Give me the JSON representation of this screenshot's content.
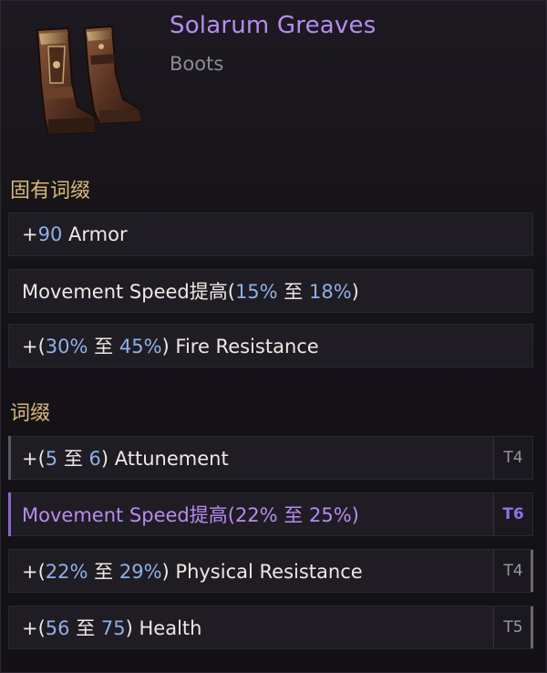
{
  "item": {
    "name": "Solarum Greaves",
    "type": "Boots"
  },
  "implicit": {
    "title": "固有词缀",
    "rows": [
      {
        "prefix": "+",
        "num1": "90",
        "suffix": " Armor"
      },
      {
        "text": "Movement Speed提高(",
        "num1": "15%",
        "mid": " 至 ",
        "num2": "18%",
        "end": ")"
      },
      {
        "prefix": "+(",
        "num1": "30%",
        "mid": " 至 ",
        "num2": "45%",
        "end": ") Fire Resistance"
      }
    ]
  },
  "affixes": {
    "title": "词缀",
    "rows": [
      {
        "prefix": "+(",
        "num1": "5",
        "mid": " 至 ",
        "num2": "6",
        "end": ") Attunement",
        "tier": "T4"
      },
      {
        "text": "Movement Speed提高(",
        "num1": "22%",
        "mid": " 至 ",
        "num2": "25%",
        "end": ")",
        "tier": "T6"
      },
      {
        "prefix": "+(",
        "num1": "22%",
        "mid": " 至 ",
        "num2": "29%",
        "end": ") Physical Resistance",
        "tier": "T4"
      },
      {
        "prefix": "+(",
        "num1": "56",
        "mid": " 至 ",
        "num2": "75",
        "end": ") Health",
        "tier": "T5"
      }
    ]
  },
  "colors": {
    "item_name": "#b58cf2",
    "section_title": "#d9b77b",
    "value_blue": "#8eb0e6",
    "magic_affix": "#b68cf0"
  }
}
